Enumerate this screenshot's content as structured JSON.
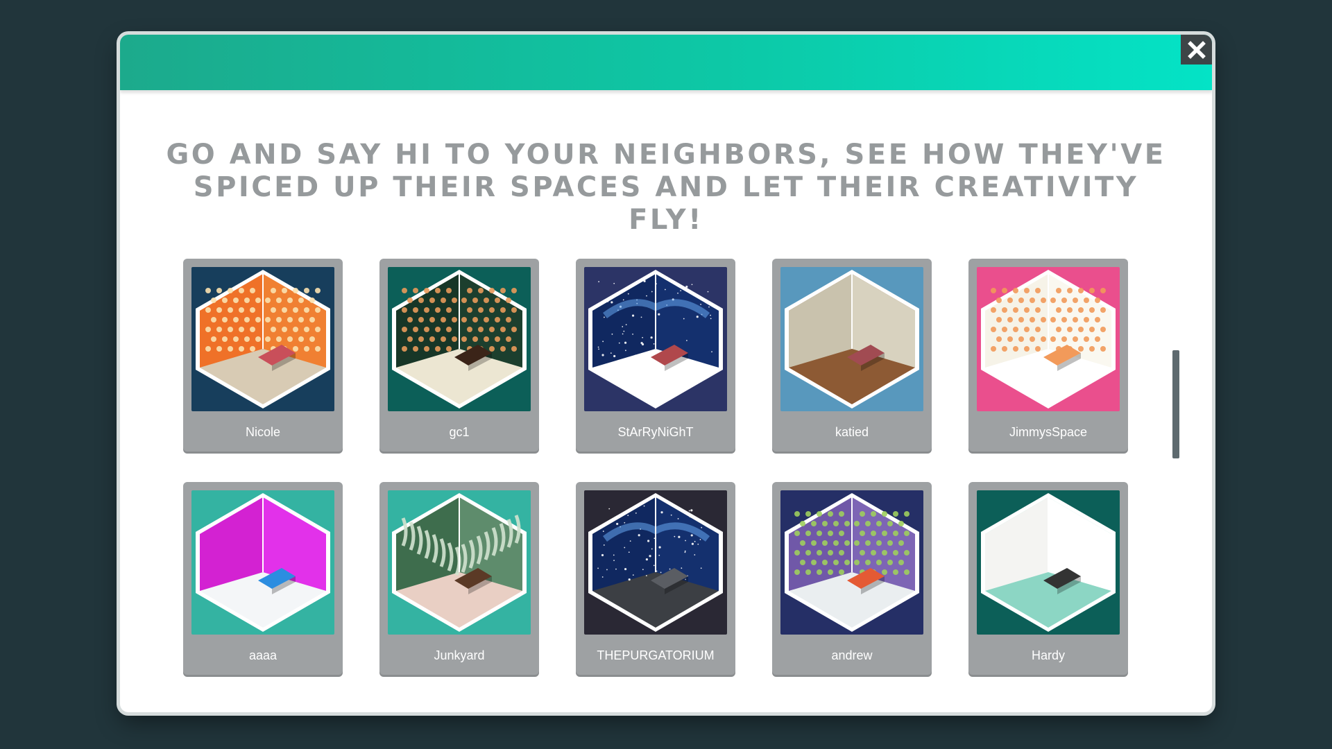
{
  "header": {
    "close_icon": "close-x-icon"
  },
  "headline": {
    "line1": "GO AND SAY HI TO YOUR NEIGHBORS, SEE HOW THEY'VE",
    "line2": "SPICED UP THEIR SPACES AND LET THEIR CREATIVITY FLY!"
  },
  "colors": {
    "backdrop": "#21353b",
    "header_gradient": [
      "#1caa8c",
      "#04e3c6"
    ],
    "card": "#9ea1a3",
    "headline_text": "#969a9c"
  },
  "rooms": [
    {
      "name": "Nicole",
      "bg": "#173e5c",
      "left_wall": "#ef7128",
      "right_wall": "#f08032",
      "floor": "#d8cbb4",
      "pattern": "dots",
      "pattern_color": "#fbe2b0",
      "accent": "#c94f5a"
    },
    {
      "name": "gc1",
      "bg": "#0c5f58",
      "left_wall": "#173627",
      "right_wall": "#1c3f2e",
      "floor": "#ece6d2",
      "pattern": "dots",
      "pattern_color": "#e89a5a",
      "accent": "#3b2418"
    },
    {
      "name": "StArRyNiGhT",
      "bg": "#2c3466",
      "left_wall": "#102860",
      "right_wall": "#14306e",
      "floor": "#ffffff",
      "pattern": "stars",
      "pattern_color": "#6fb4ff",
      "accent": "#b0484c"
    },
    {
      "name": "katied",
      "bg": "#5898bd",
      "left_wall": "#c9c2ad",
      "right_wall": "#d8d2bf",
      "floor": "#8d5a34",
      "pattern": "plain",
      "pattern_color": "#bdb59f",
      "accent": "#a14b52"
    },
    {
      "name": "JimmysSpace",
      "bg": "#ea4f8d",
      "left_wall": "#f6f3e8",
      "right_wall": "#faf8f0",
      "floor": "#ffffff",
      "pattern": "dots",
      "pattern_color": "#f29a5a",
      "accent": "#f29a5a"
    },
    {
      "name": "aaaa",
      "bg": "#34b3a2",
      "left_wall": "#d322d2",
      "right_wall": "#e231ea",
      "floor": "#f4f6f8",
      "pattern": "plain",
      "pattern_color": "#d322d2",
      "accent": "#2c8de0"
    },
    {
      "name": "Junkyard",
      "bg": "#34b3a2",
      "left_wall": "#3e6d4d",
      "right_wall": "#5e8c6c",
      "floor": "#e9cfc4",
      "pattern": "stripes",
      "pattern_color": "#d2e3d0",
      "accent": "#5b3a26"
    },
    {
      "name": "THEPURGATORIUM",
      "bg": "#2a2834",
      "left_wall": "#102860",
      "right_wall": "#14306e",
      "floor": "#3c3f44",
      "pattern": "stars",
      "pattern_color": "#6fb4ff",
      "accent": "#5a5d63"
    },
    {
      "name": "andrew",
      "bg": "#252f66",
      "left_wall": "#7058a8",
      "right_wall": "#7d65b5",
      "floor": "#eaeef0",
      "pattern": "dots",
      "pattern_color": "#9fcf5e",
      "accent": "#e45a34"
    },
    {
      "name": "Hardy",
      "bg": "#0c5f58",
      "left_wall": "#f4f4f2",
      "right_wall": "#ffffff",
      "floor": "#8cd6c4",
      "pattern": "plain",
      "pattern_color": "#dddddd",
      "accent": "#333333"
    }
  ]
}
